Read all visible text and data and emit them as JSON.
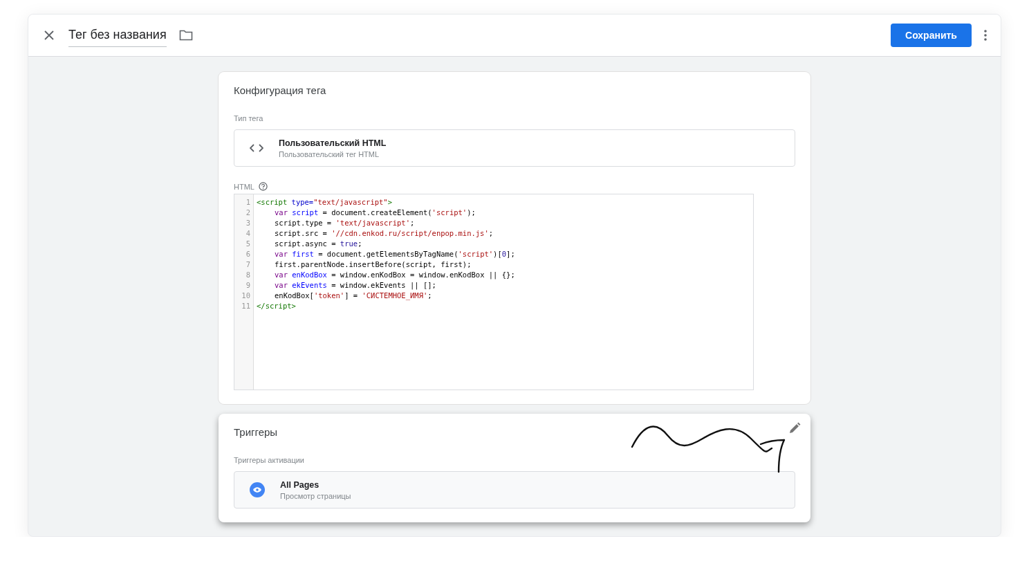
{
  "header": {
    "title": "Тег без названия",
    "save_button": "Сохранить"
  },
  "tag_config": {
    "title": "Конфигурация тега",
    "type_label": "Тип тега",
    "tag_type": {
      "name": "Пользовательский HTML",
      "description": "Пользовательский тег HTML"
    },
    "html_label": "HTML",
    "code_lines": [
      {
        "number": "1",
        "indented": false,
        "tokens": [
          {
            "kind": "tag",
            "text": "<script"
          },
          {
            "kind": "attr",
            "text": " type="
          },
          {
            "kind": "string",
            "text": "\"text/javascript\""
          },
          {
            "kind": "tag",
            "text": ">"
          }
        ]
      },
      {
        "number": "2",
        "indented": true,
        "tokens": [
          {
            "kind": "keyword",
            "text": "var "
          },
          {
            "kind": "def",
            "text": "script"
          },
          {
            "kind": "plain",
            "text": " = document.createElement("
          },
          {
            "kind": "string",
            "text": "'script'"
          },
          {
            "kind": "plain",
            "text": ");"
          }
        ]
      },
      {
        "number": "3",
        "indented": true,
        "tokens": [
          {
            "kind": "plain",
            "text": "script.type = "
          },
          {
            "kind": "string",
            "text": "'text/javascript'"
          },
          {
            "kind": "plain",
            "text": ";"
          }
        ]
      },
      {
        "number": "4",
        "indented": true,
        "tokens": [
          {
            "kind": "plain",
            "text": "script.src = "
          },
          {
            "kind": "string",
            "text": "'//cdn.enkod.ru/script/enpop.min.js'"
          },
          {
            "kind": "plain",
            "text": ";"
          }
        ]
      },
      {
        "number": "5",
        "indented": true,
        "tokens": [
          {
            "kind": "plain",
            "text": "script.async = "
          },
          {
            "kind": "atom",
            "text": "true"
          },
          {
            "kind": "plain",
            "text": ";"
          }
        ]
      },
      {
        "number": "6",
        "indented": true,
        "tokens": [
          {
            "kind": "keyword",
            "text": "var "
          },
          {
            "kind": "def",
            "text": "first"
          },
          {
            "kind": "plain",
            "text": " = document.getElementsByTagName("
          },
          {
            "kind": "string",
            "text": "'script'"
          },
          {
            "kind": "plain",
            "text": ")["
          },
          {
            "kind": "atom",
            "text": "0"
          },
          {
            "kind": "plain",
            "text": "];"
          }
        ]
      },
      {
        "number": "7",
        "indented": true,
        "tokens": [
          {
            "kind": "plain",
            "text": "first.parentNode.insertBefore(script, first);"
          }
        ]
      },
      {
        "number": "8",
        "indented": true,
        "tokens": [
          {
            "kind": "keyword",
            "text": "var "
          },
          {
            "kind": "def",
            "text": "enKodBox"
          },
          {
            "kind": "plain",
            "text": " = window.enKodBox = window.enKodBox || {};"
          }
        ]
      },
      {
        "number": "9",
        "indented": true,
        "tokens": [
          {
            "kind": "keyword",
            "text": "var "
          },
          {
            "kind": "def",
            "text": "ekEvents"
          },
          {
            "kind": "plain",
            "text": " = window.ekEvents || [];"
          }
        ]
      },
      {
        "number": "10",
        "indented": true,
        "tokens": [
          {
            "kind": "plain",
            "text": "enKodBox["
          },
          {
            "kind": "string",
            "text": "'token'"
          },
          {
            "kind": "plain",
            "text": "] = "
          },
          {
            "kind": "string",
            "text": "'СИСТЕМНОЕ_ИМЯ'"
          },
          {
            "kind": "plain",
            "text": ";"
          }
        ]
      },
      {
        "number": "11",
        "indented": false,
        "tokens": [
          {
            "kind": "tag",
            "text": "</script>"
          }
        ]
      }
    ]
  },
  "triggers": {
    "title": "Триггеры",
    "label": "Триггеры активации",
    "items": [
      {
        "name": "All Pages",
        "description": "Просмотр страницы"
      }
    ]
  }
}
